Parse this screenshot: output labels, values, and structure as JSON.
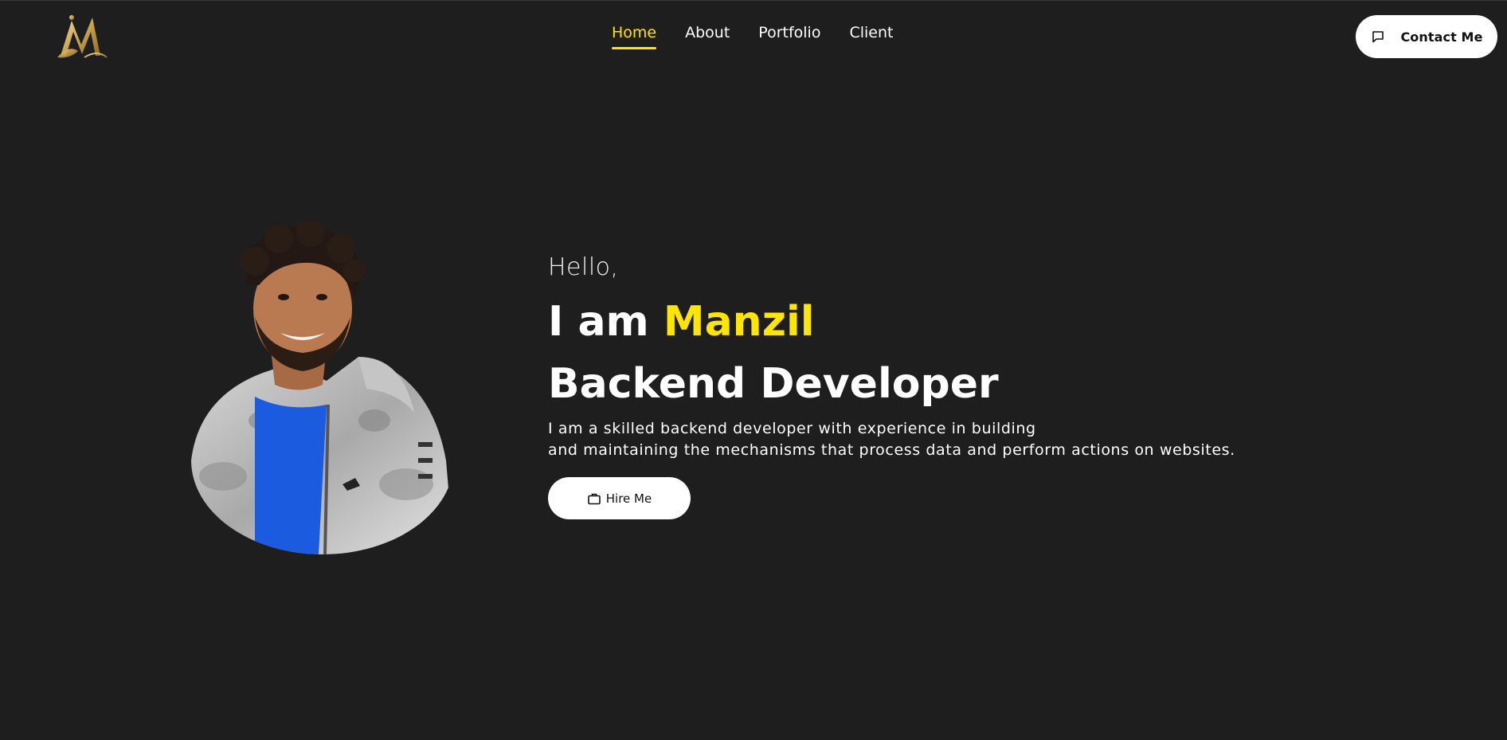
{
  "header": {
    "logo_icon": "gold-m-monogram-logo",
    "nav": [
      {
        "label": "Home",
        "active": true
      },
      {
        "label": "About",
        "active": false
      },
      {
        "label": "Portfolio",
        "active": false
      },
      {
        "label": "Client",
        "active": false
      }
    ],
    "contact_button": {
      "label": "Contact Me",
      "icon": "message-square-icon"
    }
  },
  "hero": {
    "greeting": "Hello,",
    "intro_prefix": "I am",
    "name": "Manzil",
    "role": "Backend Developer",
    "description_line1": "I am a skilled backend developer with experience in building",
    "description_line2": "and maintaining the mechanisms that process data and perform actions on websites.",
    "hire_button": {
      "label": "Hire Me",
      "icon": "briefcase-icon"
    },
    "portrait": "profile-photo"
  },
  "colors": {
    "background": "#1e1e1e",
    "accent": "#ffe600",
    "text": "#ffffff",
    "button_bg": "#ffffff"
  }
}
